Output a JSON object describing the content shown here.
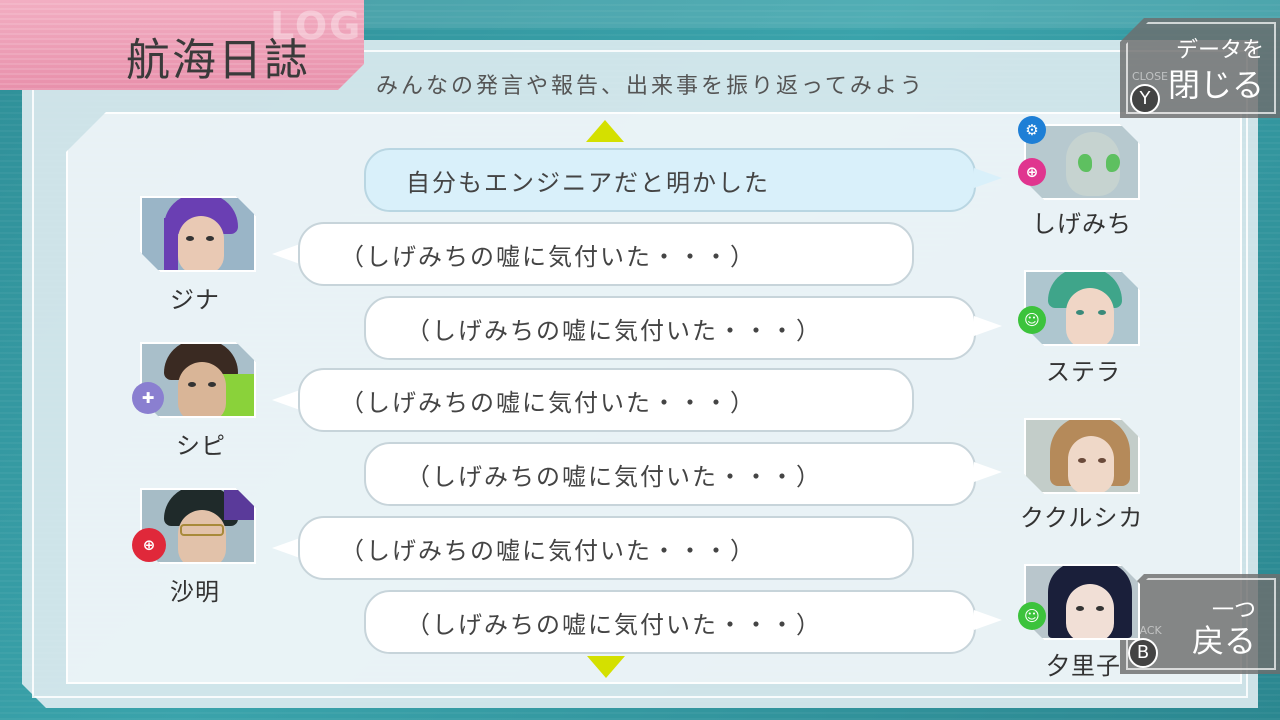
{
  "title": "航海日誌",
  "title_ghost": "LOG",
  "subtitle": "みんなの発言や報告、出来事を振り返ってみよう",
  "close_button": {
    "line1": "データを",
    "line2": "閉じる",
    "key": "Y",
    "ghost": "CLOSE"
  },
  "back_button": {
    "line1": "一つ",
    "line2": "戻る",
    "key": "B",
    "ghost": "BACK"
  },
  "colors": {
    "accent_arrow": "#d4e000",
    "title_pink": "#e890ab",
    "engineer_blue": "#1e7fd6",
    "guard_pink": "#e0358f",
    "crew_green": "#3cc33c",
    "doctor_purple": "#8a7fd0",
    "ac_red": "#e0283a"
  },
  "entries": [
    {
      "speaker": "しげみち",
      "side": "right",
      "text": "自分もエンジニアだと明かした",
      "highlight": true,
      "icons": [
        "engineer-icon",
        "guardian-icon"
      ]
    },
    {
      "speaker": "ジナ",
      "side": "left",
      "text": "（しげみちの嘘に気付いた・・・）",
      "highlight": false,
      "icons": []
    },
    {
      "speaker": "ステラ",
      "side": "right",
      "text": "（しげみちの嘘に気付いた・・・）",
      "highlight": false,
      "icons": [
        "crew-icon"
      ]
    },
    {
      "speaker": "シピ",
      "side": "left",
      "text": "（しげみちの嘘に気付いた・・・）",
      "highlight": false,
      "icons": [
        "doctor-icon"
      ]
    },
    {
      "speaker": "ククルシカ",
      "side": "right",
      "text": "（しげみちの嘘に気付いた・・・）",
      "highlight": false,
      "icons": []
    },
    {
      "speaker": "沙明",
      "side": "left",
      "text": "（しげみちの嘘に気付いた・・・）",
      "highlight": false,
      "icons": [
        "ac-follower-icon"
      ]
    },
    {
      "speaker": "夕里子",
      "side": "right",
      "text": "（しげみちの嘘に気付いた・・・）",
      "highlight": false,
      "icons": [
        "crew-icon"
      ]
    }
  ]
}
